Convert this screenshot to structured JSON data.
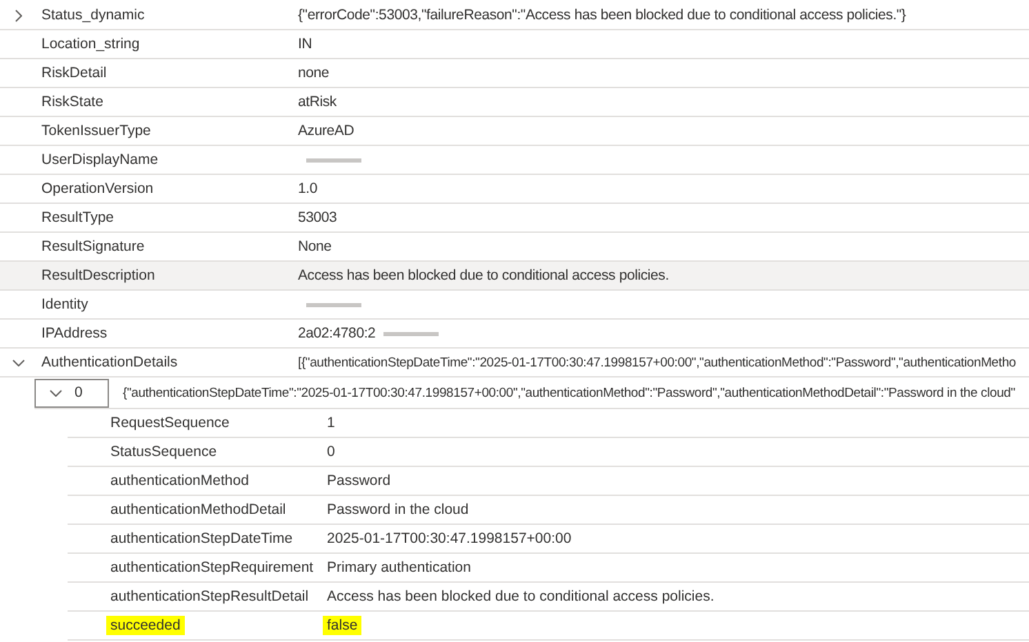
{
  "rows": [
    {
      "key": "Status_dynamic",
      "value": "{\"errorCode\":53003,\"failureReason\":\"Access has been blocked due to conditional access policies.\"}",
      "expanded": false,
      "selected": false
    },
    {
      "key": "Location_string",
      "value": "IN",
      "selected": false
    },
    {
      "key": "RiskDetail",
      "value": "none",
      "selected": false
    },
    {
      "key": "RiskState",
      "value": "atRisk",
      "selected": false
    },
    {
      "key": "TokenIssuerType",
      "value": "AzureAD",
      "selected": false
    },
    {
      "key": "UserDisplayName",
      "redacted": true,
      "selected": false
    },
    {
      "key": "OperationVersion",
      "value": "1.0",
      "selected": false
    },
    {
      "key": "ResultType",
      "value": "53003",
      "selected": false
    },
    {
      "key": "ResultSignature",
      "value": "None",
      "selected": false
    },
    {
      "key": "ResultDescription",
      "value": "Access has been blocked due to conditional access policies.",
      "selected": true
    },
    {
      "key": "Identity",
      "redacted": true,
      "selected": false
    },
    {
      "key": "IPAddress",
      "value": "2a02:4780:2",
      "redacted": true,
      "selected": false
    },
    {
      "key": "AuthenticationDetails",
      "value": "[{\"authenticationStepDateTime\":\"2025-01-17T00:30:47.1998157+00:00\",\"authenticationMethod\":\"Password\",\"authenticationMetho",
      "expanded": true,
      "selected": false,
      "children": [
        {
          "index": "0",
          "value": "{\"authenticationStepDateTime\":\"2025-01-17T00:30:47.1998157+00:00\",\"authenticationMethod\":\"Password\",\"authenticationMethodDetail\":\"Password in the cloud\"",
          "expanded": true,
          "fields": [
            {
              "key": "RequestSequence",
              "value": "1",
              "highlighted": false
            },
            {
              "key": "StatusSequence",
              "value": "0",
              "highlighted": false
            },
            {
              "key": "authenticationMethod",
              "value": "Password",
              "highlighted": false
            },
            {
              "key": "authenticationMethodDetail",
              "value": "Password in the cloud",
              "highlighted": false
            },
            {
              "key": "authenticationStepDateTime",
              "value": "2025-01-17T00:30:47.1998157+00:00",
              "highlighted": false
            },
            {
              "key": "authenticationStepRequirement",
              "value": "Primary authentication",
              "highlighted": false
            },
            {
              "key": "authenticationStepResultDetail",
              "value": "Access has been blocked due to conditional access policies.",
              "highlighted": false
            },
            {
              "key": "succeeded",
              "value": "false",
              "highlighted": true
            }
          ]
        }
      ]
    }
  ]
}
